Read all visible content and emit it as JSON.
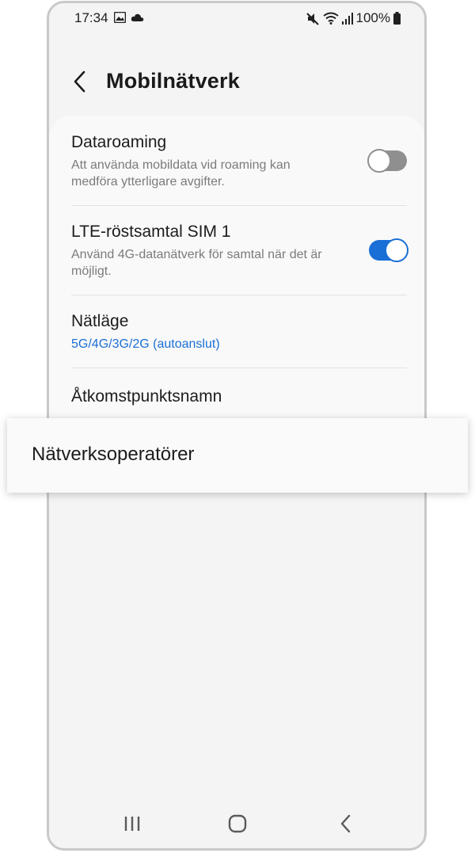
{
  "status_bar": {
    "time": "17:34",
    "battery": "100%",
    "left_icons": [
      "image-icon",
      "cloud-icon"
    ],
    "right_icons": [
      "mute-icon",
      "wifi-icon",
      "signal-icon",
      "battery-icon"
    ]
  },
  "header": {
    "back_icon": "chevron-left-icon",
    "title": "Mobilnätverk"
  },
  "settings": {
    "data_roaming": {
      "title": "Dataroaming",
      "subtitle": "Att använda mobildata vid roaming kan medföra ytterligare avgifter.",
      "toggle_state": "off"
    },
    "lte_voice": {
      "title": "LTE-röstsamtal SIM 1",
      "subtitle": "Använd 4G-datanätverk för samtal när det är möjligt.",
      "toggle_state": "on"
    },
    "network_mode": {
      "title": "Nätläge",
      "value": "5G/4G/3G/2G (autoanslut)"
    },
    "apn": {
      "title": "Åtkomstpunktsnamn"
    }
  },
  "highlight": {
    "label": "Nätverksoperatörer"
  },
  "nav_bar": {
    "buttons": [
      "recents-icon",
      "home-icon",
      "back-nav-icon"
    ]
  },
  "colors": {
    "accent": "#1a6fd6",
    "toggle_off": "#8f8f8f",
    "background": "#f4f4f4",
    "card": "#f9f9f9"
  }
}
